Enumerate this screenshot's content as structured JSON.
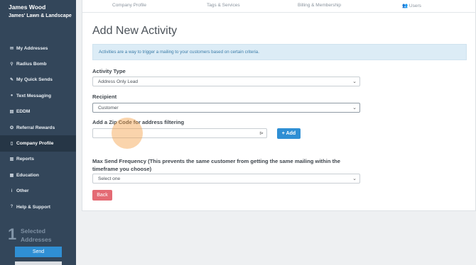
{
  "sidebar": {
    "user_name": "James Wood",
    "business_name": "James' Lawn & Landscape",
    "items": [
      {
        "label": "My Addresses",
        "icon": "envelope-icon",
        "glyph": "✉"
      },
      {
        "label": "Radius Bomb",
        "icon": "map-pin-icon",
        "glyph": "⚲"
      },
      {
        "label": "My Quick Sends",
        "icon": "pin-icon",
        "glyph": "✎"
      },
      {
        "label": "Text Messaging",
        "icon": "chat-bubble-icon",
        "glyph": "●"
      },
      {
        "label": "EDDM",
        "icon": "postal-icon",
        "glyph": "▤"
      },
      {
        "label": "Referral Rewards",
        "icon": "rewards-icon",
        "glyph": "✪"
      },
      {
        "label": "Company Profile",
        "icon": "document-icon",
        "glyph": "▯",
        "active": true
      },
      {
        "label": "Reports",
        "icon": "chart-icon",
        "glyph": "▥"
      },
      {
        "label": "Education",
        "icon": "institution-icon",
        "glyph": "▦"
      },
      {
        "label": "Other",
        "icon": "info-icon",
        "glyph": "i"
      },
      {
        "label": "Help & Support",
        "icon": "question-icon",
        "glyph": "?"
      }
    ],
    "selected_count": "1",
    "selected_label": "Selected Addresses",
    "send_label": "Send"
  },
  "tabs": [
    "Company Profile",
    "Tags & Services",
    "Billing & Membership",
    "Users"
  ],
  "main": {
    "title": "Add New Activity",
    "info": "Activities are a way to trigger a mailing to your customers based on certain criteria.",
    "activity_type_label": "Activity Type",
    "activity_type_value": "Address Only Lead",
    "recipient_label": "Recipient",
    "recipient_value": "Customer",
    "zip_label": "Add a Zip Code for address filtering",
    "zip_value": "",
    "add_label": "+ Add",
    "freq_label": "Max Send Frequency (This prevents the same customer from getting the same mailing within the timeframe you choose)",
    "freq_value": "Select one",
    "back_label": "Back"
  },
  "colors": {
    "sidebar": "#33465a",
    "accent": "#2f8fd4",
    "danger": "#e46a74",
    "info_bg": "#dcecf6"
  }
}
